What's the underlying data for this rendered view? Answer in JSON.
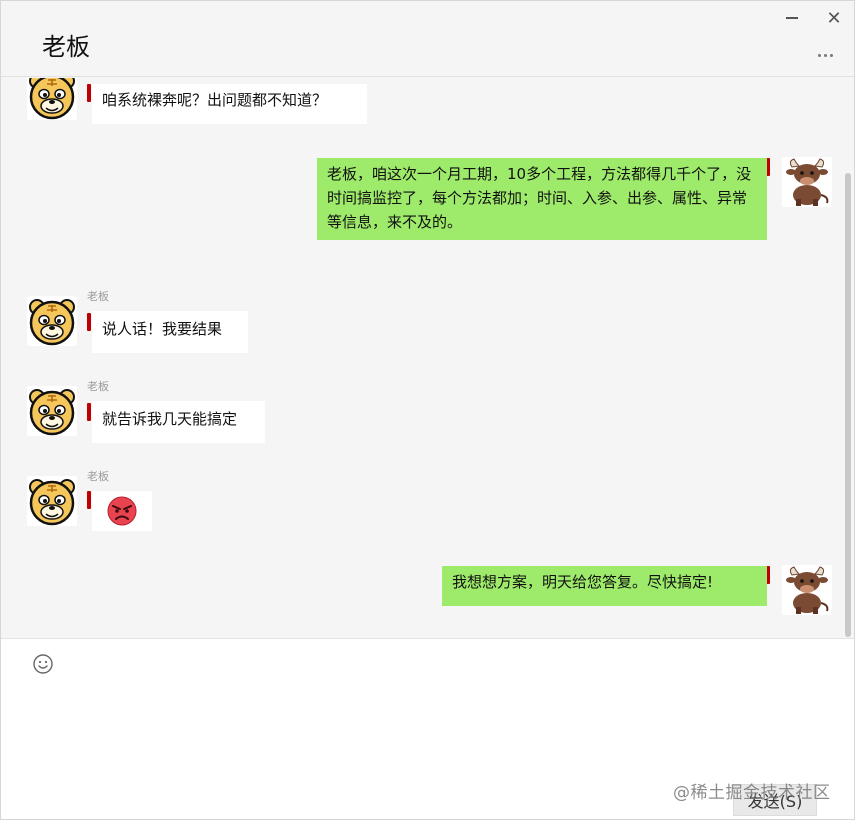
{
  "window": {
    "title": "老板",
    "minimize_icon": "minimize-icon",
    "close_icon": "close-icon",
    "close_glyph": "✕",
    "more_icon": "more-icon"
  },
  "messages": [
    {
      "side": "left",
      "sender": "",
      "text": "咱系统裸奔呢？出问题都不知道？"
    },
    {
      "side": "right",
      "text": "老板，咱这次一个月工期，10多个工程，方法都得几千个了，没时间搞监控了，每个方法都加；时间、入参、出参、属性、异常等信息，来不及的。"
    },
    {
      "side": "left",
      "sender": "老板",
      "text": "说人话！我要结果"
    },
    {
      "side": "left",
      "sender": "老板",
      "text": "就告诉我几天能搞定"
    },
    {
      "side": "left",
      "sender": "老板",
      "sticker": "angry-face-icon"
    },
    {
      "side": "right",
      "text": "我想想方案，明天给您答复。尽快搞定!"
    }
  ],
  "colors": {
    "self_bubble": "#9eea6a",
    "other_bubble": "#ffffff",
    "mark": "#c00000",
    "background": "#f5f5f5"
  },
  "input": {
    "emoji_icon": "smiley-icon",
    "value": "",
    "send_label": "发送(S)"
  },
  "watermark": "@稀土掘金技术社区"
}
